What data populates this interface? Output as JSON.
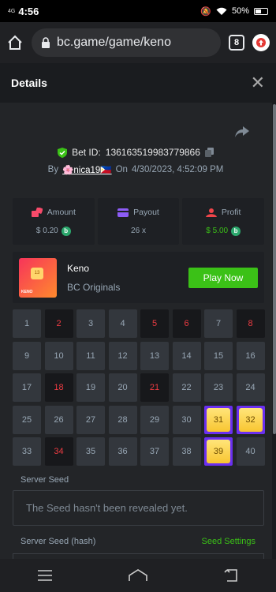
{
  "statusbar": {
    "network": "4G",
    "time": "4:56",
    "battery": "50%"
  },
  "browser": {
    "url": "bc.game/game/keno",
    "tab_count": "8"
  },
  "details": {
    "title": "Details",
    "close": "✕"
  },
  "bet": {
    "id_label": "Bet ID:",
    "id": "136163519983779866",
    "by_label": "By",
    "user": "🌸nica19🇵🇭",
    "on_label": "On",
    "datetime": "4/30/2023, 4:52:09 PM"
  },
  "stats": {
    "amount_label": "Amount",
    "amount_value": "$ 0.20",
    "payout_label": "Payout",
    "payout_value": "26 x",
    "profit_label": "Profit",
    "profit_value": "$ 5.00"
  },
  "game": {
    "name": "Keno",
    "provider": "BC Originals",
    "play_label": "Play Now",
    "thumb_text": "KENO",
    "thumb_tile": "13"
  },
  "grid": {
    "numbers": [
      1,
      2,
      3,
      4,
      5,
      6,
      7,
      8,
      9,
      10,
      11,
      12,
      13,
      14,
      15,
      16,
      17,
      18,
      19,
      20,
      21,
      22,
      23,
      24,
      25,
      26,
      27,
      28,
      29,
      30,
      31,
      32,
      33,
      34,
      35,
      36,
      37,
      38,
      39,
      40
    ],
    "drawn_misses": [
      2,
      5,
      6,
      8,
      18,
      21,
      34
    ],
    "hits": [
      31,
      32,
      39
    ]
  },
  "seed": {
    "server_seed_label": "Server Seed",
    "server_seed_value": "The Seed hasn't been revealed yet.",
    "hash_label": "Server Seed (hash)",
    "settings_label": "Seed Settings"
  },
  "colors": {
    "accent_green": "#3bc117",
    "miss_red": "#ed3b42",
    "hit_purple": "#6a2ff0"
  }
}
